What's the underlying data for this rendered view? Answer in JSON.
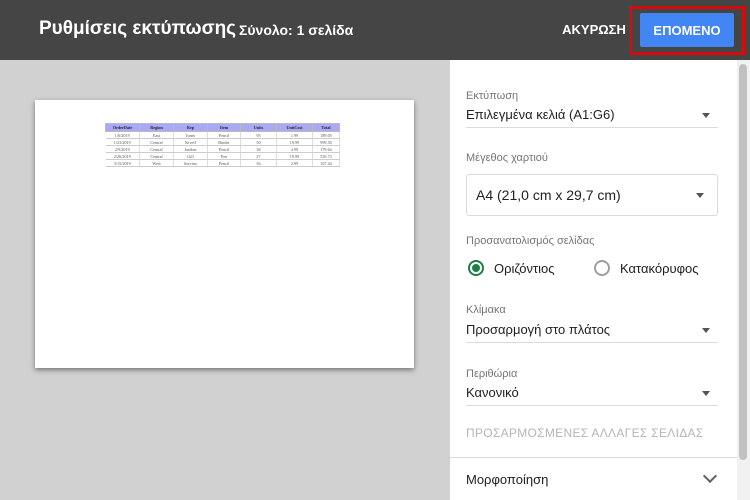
{
  "header": {
    "title": "Ρυθμίσεις εκτύπωσης",
    "subtitle": "Σύνολο: 1 σελίδα",
    "cancel_label": "ΑΚΥΡΩΣΗ",
    "next_label": "ΕΠΟΜΕΝΟ"
  },
  "settings": {
    "print": {
      "label": "Εκτύπωση",
      "value": "Επιλεγμένα κελιά (A1:G6)"
    },
    "paper_size": {
      "label": "Μέγεθος χαρτιού",
      "value": "A4 (21,0 cm x 29,7 cm)"
    },
    "orientation": {
      "label": "Προσανατολισμός σελίδας",
      "options": [
        "Οριζόντιος",
        "Κατακόρυφος"
      ],
      "selected": "Οριζόντιος"
    },
    "scale": {
      "label": "Κλίμακα",
      "value": "Προσαρμογή στο πλάτος"
    },
    "margins": {
      "label": "Περιθώρια",
      "value": "Κανονικό"
    },
    "custom_page_breaks": "ΠΡΟΣΑΡΜΟΣΜΕΝΕΣ ΑΛΛΑΓΕΣ ΣΕΛΙΔΑΣ",
    "formatting": "Μορφοποίηση"
  },
  "preview": {
    "headers": [
      "OrderDate",
      "Region",
      "Rep",
      "Item",
      "Units",
      "UnitCost",
      "Total"
    ],
    "rows": [
      [
        "1/6/2019",
        "East",
        "Jones",
        "Pencil",
        "95",
        "1.99",
        "189.05"
      ],
      [
        "1/23/2019",
        "Central",
        "Kivell",
        "Binder",
        "50",
        "19.99",
        "999.50"
      ],
      [
        "2/9/2019",
        "Central",
        "Jardine",
        "Pencil",
        "36",
        "4.99",
        "179.64"
      ],
      [
        "2/26/2019",
        "Central",
        "Gill",
        "Pen",
        "27",
        "19.99",
        "539.73"
      ],
      [
        "3/15/2019",
        "West",
        "Sorvino",
        "Pencil",
        "56",
        "2.99",
        "167.44"
      ]
    ]
  },
  "colors": {
    "header_bg": "#454545",
    "primary_button": "#4285f4",
    "highlight_border": "#d60b0b",
    "radio_selected": "#1e7e45",
    "preview_bg": "#d1d1d1",
    "table_header_bg": "#a9a9f5"
  }
}
